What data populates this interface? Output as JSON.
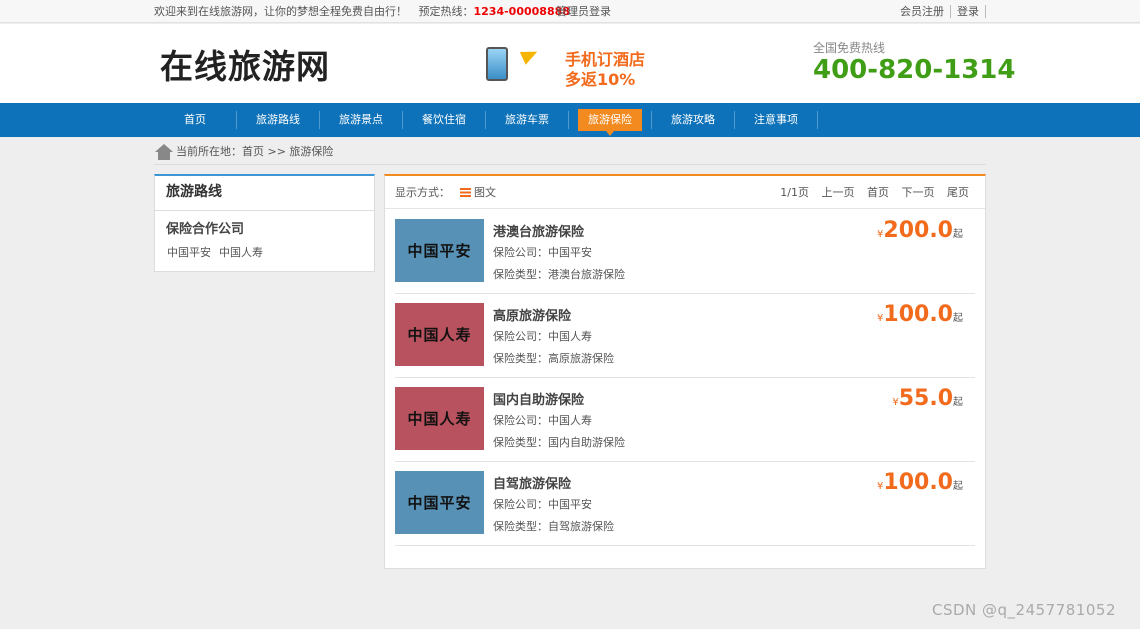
{
  "topbar": {
    "welcome": "欢迎来到在线旅游网，让你的梦想全程免费自由行！",
    "hotline_label": "预定热线：",
    "hotline_number": "1234-00008888",
    "admin_login": "管理员登录",
    "register": "会员注册",
    "login": "登录"
  },
  "header": {
    "logo": "在线旅游网",
    "promo_line1": "手机订酒店",
    "promo_line2": "多返10%",
    "free_hotline_label": "全国免费热线",
    "free_hotline_number": "400-820-1314"
  },
  "nav": {
    "items": [
      "首页",
      "旅游路线",
      "旅游景点",
      "餐饮住宿",
      "旅游车票",
      "旅游保险",
      "旅游攻略",
      "注意事项"
    ],
    "active": "旅游保险"
  },
  "breadcrumb": {
    "text": "当前所在地：首页 >> 旅游保险"
  },
  "sidebar": {
    "title": "旅游路线",
    "section": "保险合作公司",
    "links": [
      "中国平安",
      "中国人寿"
    ]
  },
  "toolbar": {
    "mode_label": "显示方式：",
    "mode_value": "图文",
    "page_info": "1/1页",
    "prev": "上一页",
    "first": "首页",
    "next": "下一页",
    "last": "尾页"
  },
  "items": [
    {
      "title": "港澳台旅游保险",
      "company_line": "保险公司：中国平安",
      "type_line": "保险类型：港澳台旅游保险",
      "thumb_text": "中国平安",
      "thumb_color": "#5891b6",
      "currency": "¥",
      "price": "200.0",
      "suffix": "起"
    },
    {
      "title": "高原旅游保险",
      "company_line": "保险公司：中国人寿",
      "type_line": "保险类型：高原旅游保险",
      "thumb_text": "中国人寿",
      "thumb_color": "#b9525f",
      "currency": "¥",
      "price": "100.0",
      "suffix": "起"
    },
    {
      "title": "国内自助游保险",
      "company_line": "保险公司：中国人寿",
      "type_line": "保险类型：国内自助游保险",
      "thumb_text": "中国人寿",
      "thumb_color": "#b9525f",
      "currency": "¥",
      "price": "55.0",
      "suffix": "起"
    },
    {
      "title": "自驾旅游保险",
      "company_line": "保险公司：中国平安",
      "type_line": "保险类型：自驾旅游保险",
      "thumb_text": "中国平安",
      "thumb_color": "#5891b6",
      "currency": "¥",
      "price": "100.0",
      "suffix": "起"
    }
  ],
  "watermark": "CSDN @q_2457781052",
  "colors": {
    "nav_bg": "#0d72b9",
    "accent_orange": "#f28a1f",
    "price": "#f26b1d",
    "hotline_green": "#3f9e16"
  }
}
